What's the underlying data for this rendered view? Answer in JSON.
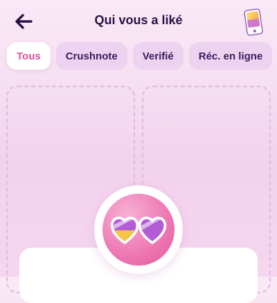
{
  "header": {
    "title": "Qui vous a liké",
    "back_icon": "arrow-left-icon",
    "right_icon": "phone-boost-icon"
  },
  "tabs": [
    {
      "label": "Tous",
      "active": true
    },
    {
      "label": "Crushnote",
      "active": false
    },
    {
      "label": "Verifié",
      "active": false
    },
    {
      "label": "Réc. en ligne",
      "active": false
    }
  ],
  "badge": {
    "icon": "heart-sunglasses-icon"
  },
  "colors": {
    "accent": "#e2519b",
    "text_dark": "#2a1146",
    "tab_bg": "#ead0ee",
    "badge_pink": "#ee7ab4",
    "heart_purple": "#b25cd6",
    "heart_yellow": "#f5c646"
  }
}
